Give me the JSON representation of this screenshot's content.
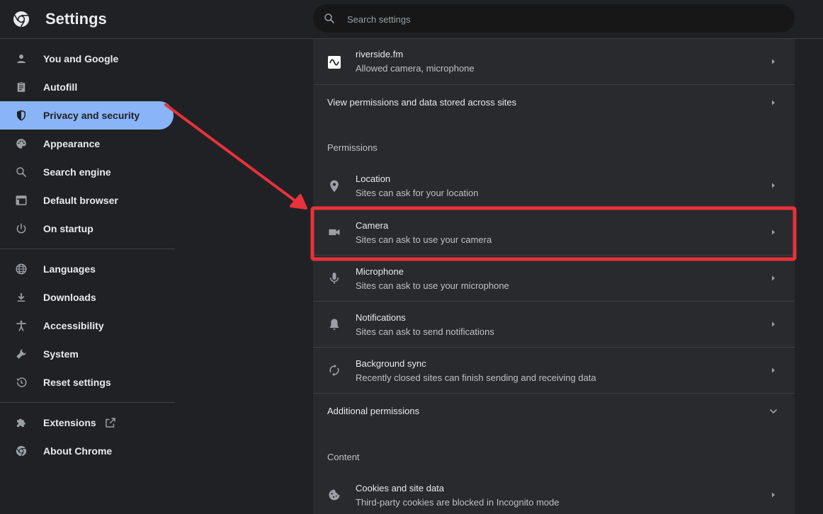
{
  "header": {
    "title": "Settings",
    "search_placeholder": "Search settings"
  },
  "sidebar": {
    "items": [
      {
        "label": "You and Google",
        "icon": "person-icon"
      },
      {
        "label": "Autofill",
        "icon": "clipboard-icon"
      },
      {
        "label": "Privacy and security",
        "icon": "shield-icon",
        "active": true
      },
      {
        "label": "Appearance",
        "icon": "palette-icon"
      },
      {
        "label": "Search engine",
        "icon": "search-icon"
      },
      {
        "label": "Default browser",
        "icon": "browser-window-icon"
      },
      {
        "label": "On startup",
        "icon": "power-icon"
      },
      {
        "label": "Languages",
        "icon": "globe-icon"
      },
      {
        "label": "Downloads",
        "icon": "download-icon"
      },
      {
        "label": "Accessibility",
        "icon": "accessibility-icon"
      },
      {
        "label": "System",
        "icon": "wrench-icon"
      },
      {
        "label": "Reset settings",
        "icon": "history-icon"
      },
      {
        "label": "Extensions",
        "icon": "puzzle-icon"
      },
      {
        "label": "About Chrome",
        "icon": "chrome-icon"
      }
    ]
  },
  "main": {
    "site_row": {
      "title": "riverside.fm",
      "subtitle": "Allowed camera, microphone"
    },
    "view_permissions": "View permissions and data stored across sites",
    "permissions_label": "Permissions",
    "permissions": [
      {
        "title": "Location",
        "subtitle": "Sites can ask for your location",
        "icon": "location-pin-icon"
      },
      {
        "title": "Camera",
        "subtitle": "Sites can ask to use your camera",
        "icon": "camera-icon"
      },
      {
        "title": "Microphone",
        "subtitle": "Sites can ask to use your microphone",
        "icon": "microphone-icon"
      },
      {
        "title": "Notifications",
        "subtitle": "Sites can ask to send notifications",
        "icon": "bell-icon"
      },
      {
        "title": "Background sync",
        "subtitle": "Recently closed sites can finish sending and receiving data",
        "icon": "sync-icon"
      }
    ],
    "additional_permissions": "Additional permissions",
    "content_label": "Content",
    "cookies": {
      "title": "Cookies and site data",
      "subtitle": "Third-party cookies are blocked in Incognito mode"
    }
  },
  "colors": {
    "background": "#202124",
    "panel": "#292a2d",
    "accent": "#8ab4f8",
    "annotation_red": "#e8323c"
  }
}
